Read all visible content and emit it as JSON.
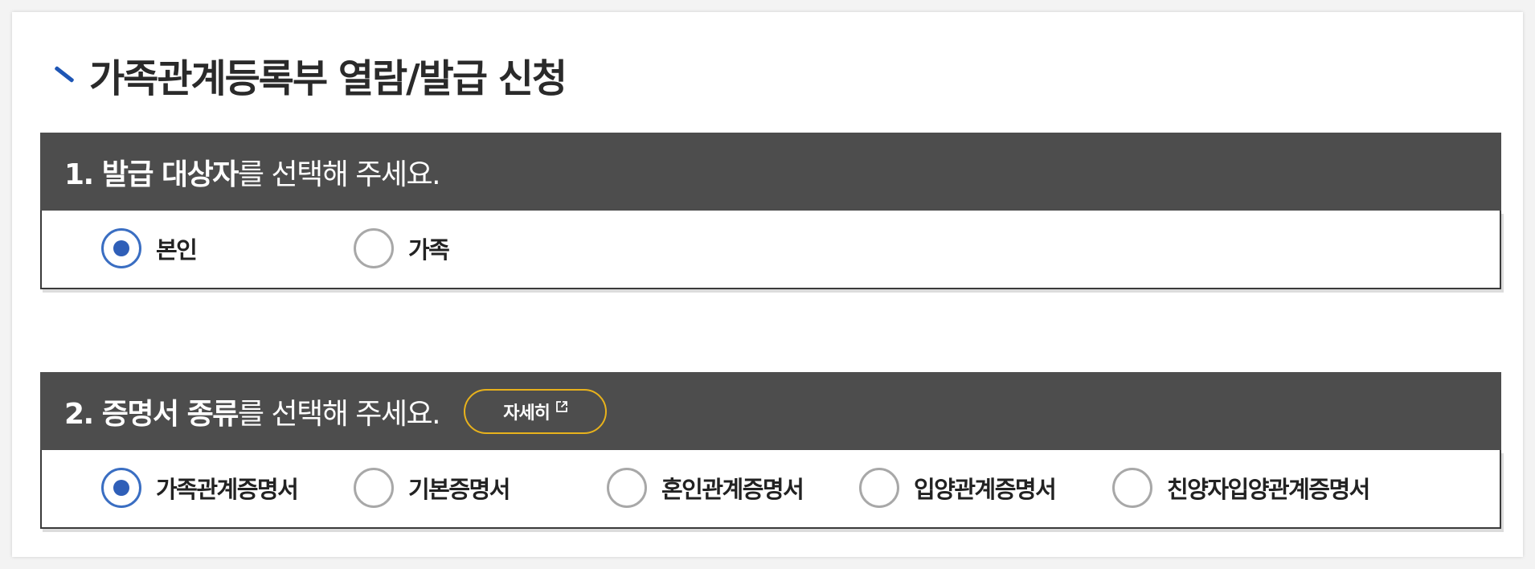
{
  "page": {
    "title": "가족관계등록부 열람/발급 신청",
    "accent_color": "#1e56b5"
  },
  "section1": {
    "number_bold": "1. 발급 대상자",
    "rest": "를 선택해 주세요.",
    "options": [
      {
        "label": "본인",
        "checked": true
      },
      {
        "label": "가족",
        "checked": false
      }
    ]
  },
  "section2": {
    "number_bold": "2. 증명서 종류",
    "rest": "를 선택해 주세요.",
    "detail_button": {
      "label": "자세히",
      "icon": "external-link-icon"
    },
    "options": [
      {
        "label": "가족관계증명서",
        "checked": true
      },
      {
        "label": "기본증명서",
        "checked": false
      },
      {
        "label": "혼인관계증명서",
        "checked": false
      },
      {
        "label": "입양관계증명서",
        "checked": false
      },
      {
        "label": "친양자입양관계증명서",
        "checked": false
      }
    ]
  },
  "colors": {
    "header_bg": "#4d4d4d",
    "radio_checked": "#2f5fb8",
    "detail_border": "#e8b21c"
  }
}
